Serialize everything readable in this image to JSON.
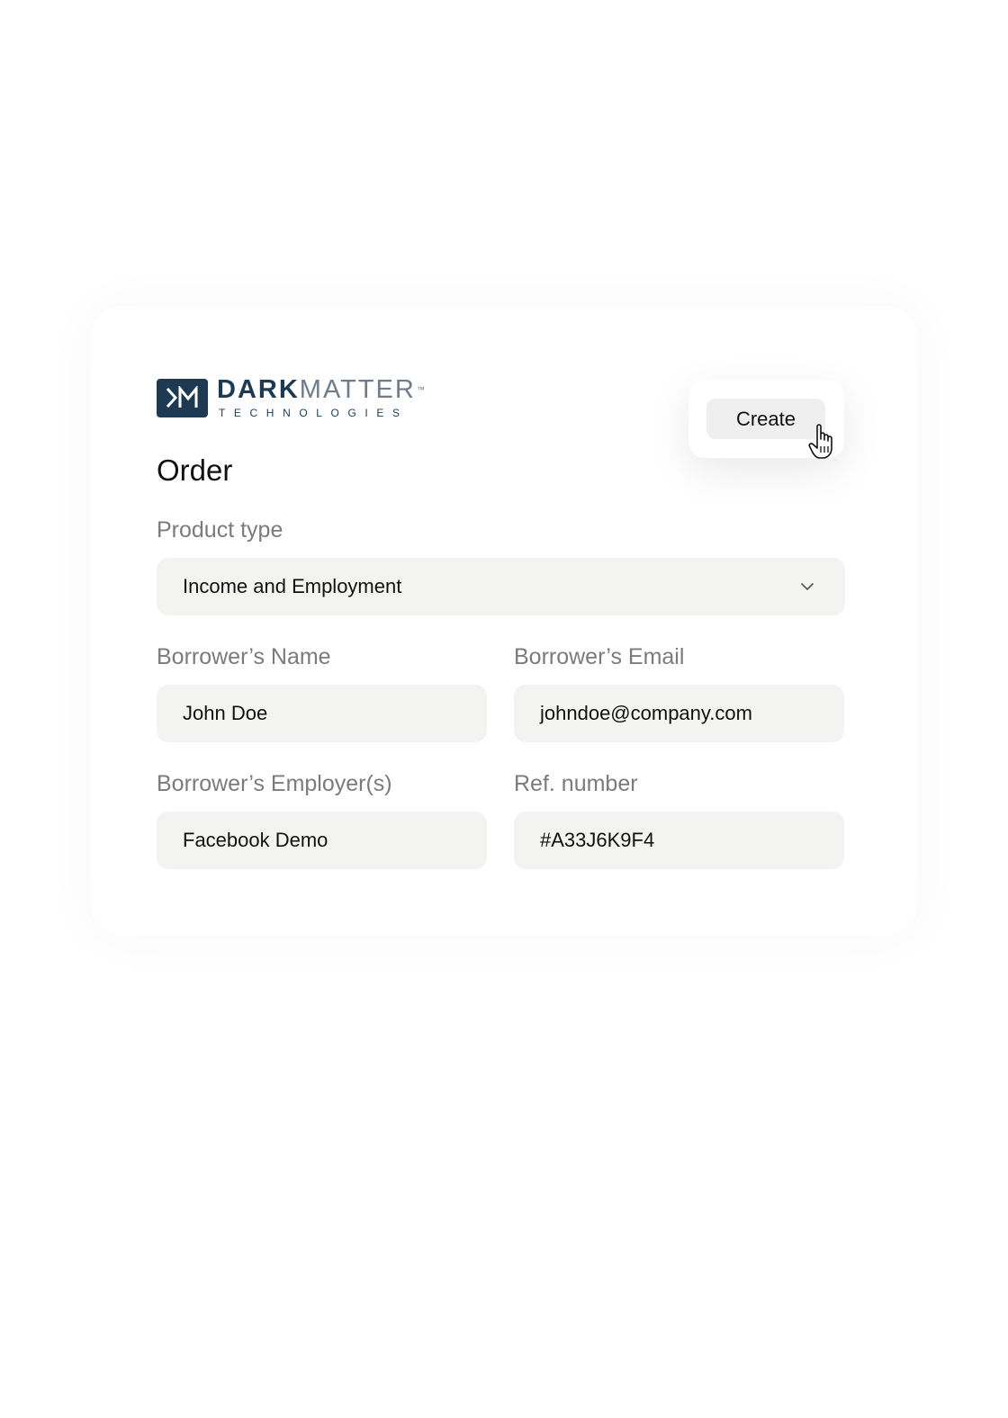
{
  "brand": {
    "name_bold": "DARK",
    "name_light": "MATTER",
    "trademark": "™",
    "subtitle": "TECHNOLOGIES",
    "color": "#1e3a52"
  },
  "header": {
    "create_label": "Create"
  },
  "form": {
    "title": "Order",
    "product_type": {
      "label": "Product type",
      "value": "Income and Employment"
    },
    "borrower_name": {
      "label": "Borrower’s Name",
      "value": "John Doe"
    },
    "borrower_email": {
      "label": "Borrower’s Email",
      "value": "johndoe@company.com"
    },
    "borrower_employer": {
      "label": "Borrower’s Employer(s)",
      "value": "Facebook Demo"
    },
    "ref_number": {
      "label": "Ref. number",
      "value": "#A33J6K9F4"
    }
  },
  "icons": {
    "logo": "dm-logo-icon",
    "dropdown": "chevron-down-icon",
    "cursor": "hand-pointer-icon"
  }
}
